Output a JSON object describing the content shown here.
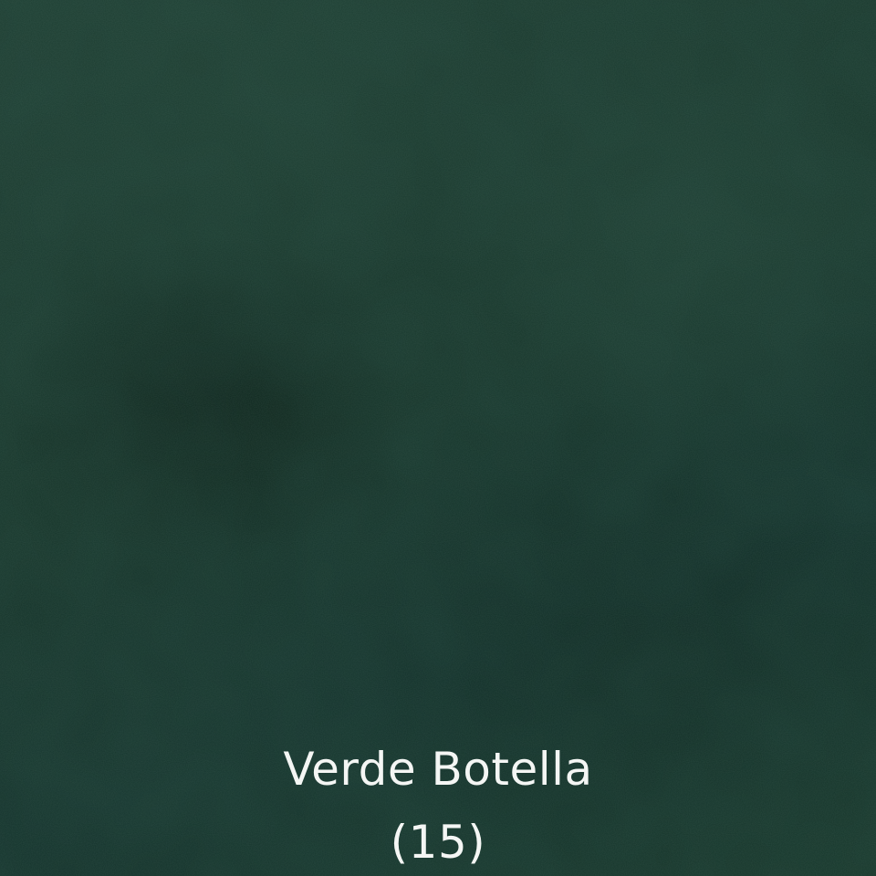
{
  "swatch": {
    "color_hex": "#17362b",
    "name": "Verde Botella",
    "code": "(15)"
  }
}
